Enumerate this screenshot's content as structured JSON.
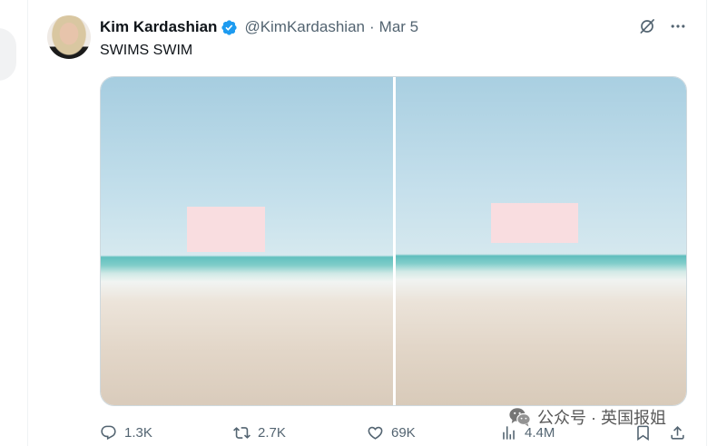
{
  "tweet": {
    "author": {
      "name": "Kim Kardashian",
      "handle": "@KimKardashian",
      "separator": "·",
      "date": "Mar 5"
    },
    "text": "SWIMS SWIM",
    "stats": {
      "replies": "1.3K",
      "reposts": "2.7K",
      "likes": "69K",
      "views": "4.4M"
    }
  },
  "watermark": {
    "text": "公众号 · 英国报姐"
  },
  "icons": {
    "verified": "verified-badge-icon",
    "grok": "grok-icon",
    "more": "more-icon",
    "reply": "reply-icon",
    "repost": "repost-icon",
    "like": "heart-icon",
    "views": "views-chart-icon",
    "bookmark": "bookmark-icon",
    "share": "share-icon",
    "watermark_logo": "wechat-icon"
  },
  "colors": {
    "accent": "#1d9bf0",
    "text_primary": "#0f1419",
    "text_secondary": "#536471",
    "border": "#eff3f4",
    "censor_box": "#f9dde0"
  }
}
